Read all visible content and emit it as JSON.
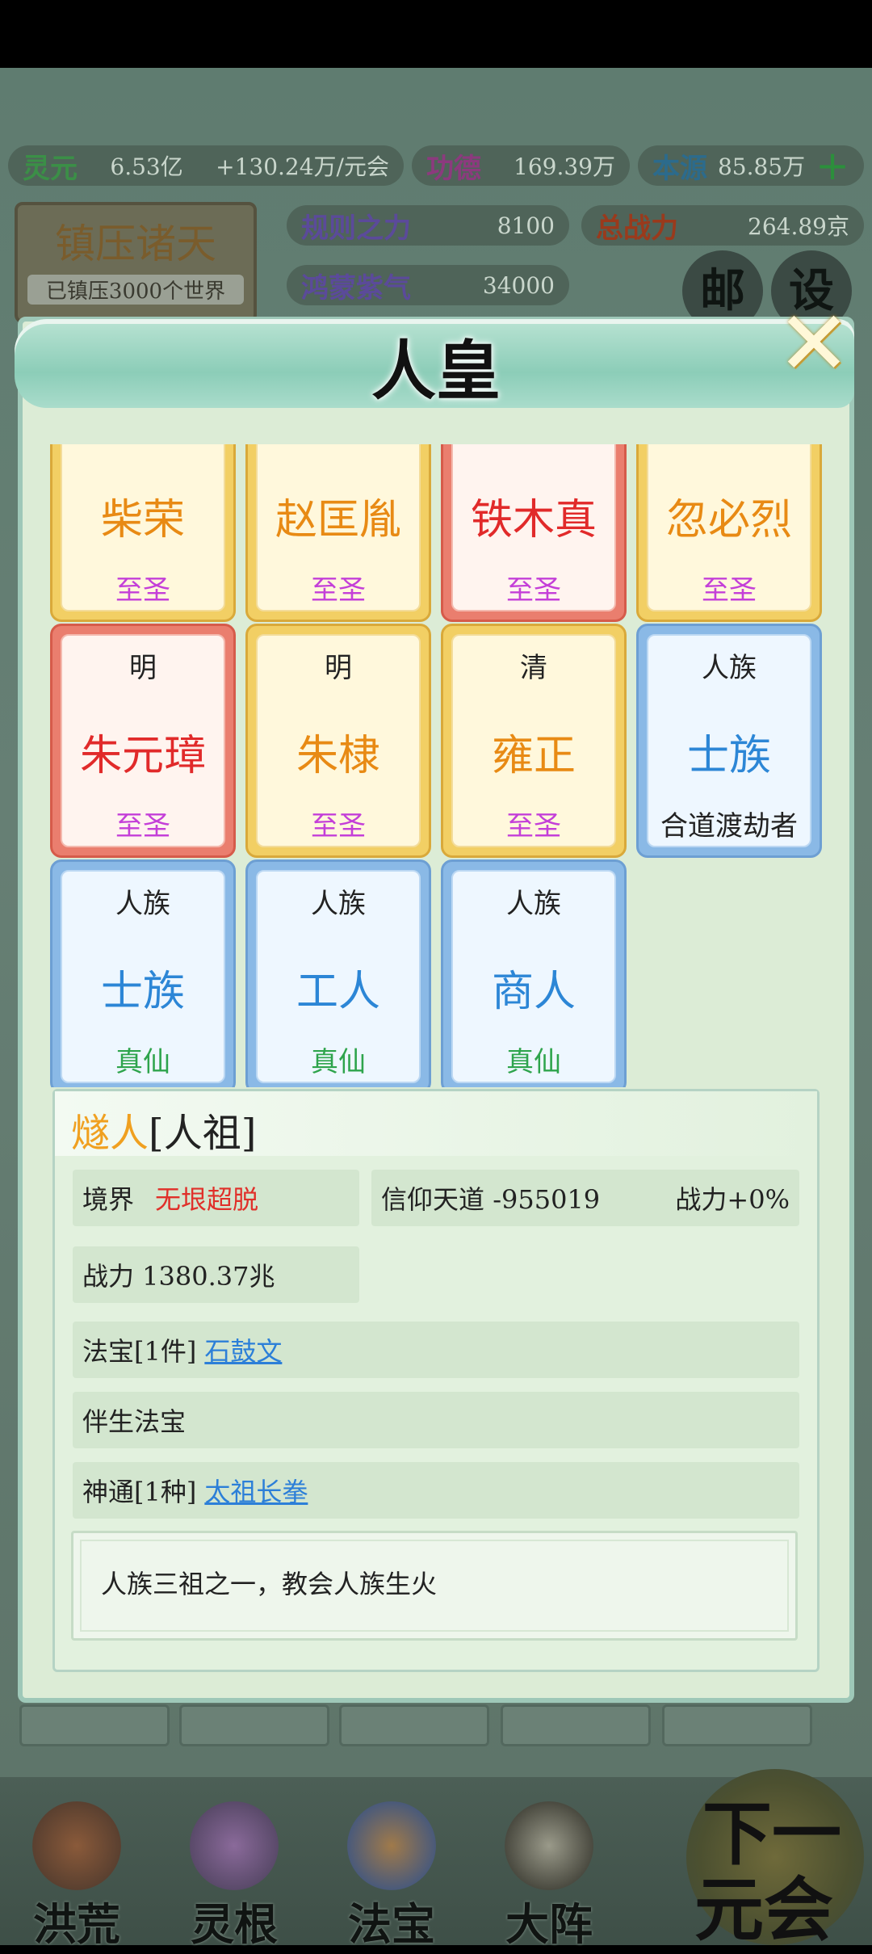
{
  "resources": {
    "lingyuan": {
      "label": "灵元",
      "value": "6.53亿",
      "rate": "+130.24万/元会"
    },
    "gongde": {
      "label": "功德",
      "value": "169.39万"
    },
    "benyuan": {
      "label": "本源",
      "value": "85.85万"
    },
    "guize": {
      "label": "规则之力",
      "value": "8100"
    },
    "zongzhanli": {
      "label": "总战力",
      "value": "264.89京"
    },
    "hongmeng": {
      "label": "鸿蒙紫气",
      "value": "34000"
    }
  },
  "title_board": {
    "title": "镇压诸天",
    "subtitle": "已镇压3000个世界"
  },
  "round_buttons": {
    "mail": "邮",
    "settings": "设"
  },
  "dialog": {
    "title": "人皇",
    "close": "✕"
  },
  "cards": [
    {
      "top": "",
      "name": "柴荣",
      "rank": "至圣",
      "style": "gold",
      "rank_color": "purple"
    },
    {
      "top": "",
      "name": "赵匡胤",
      "rank": "至圣",
      "style": "gold",
      "rank_color": "purple"
    },
    {
      "top": "",
      "name": "铁木真",
      "rank": "至圣",
      "style": "red",
      "rank_color": "purple"
    },
    {
      "top": "",
      "name": "忽必烈",
      "rank": "至圣",
      "style": "gold",
      "rank_color": "purple"
    },
    {
      "top": "明",
      "name": "朱元璋",
      "rank": "至圣",
      "style": "red",
      "rank_color": "purple"
    },
    {
      "top": "明",
      "name": "朱棣",
      "rank": "至圣",
      "style": "gold",
      "rank_color": "purple"
    },
    {
      "top": "清",
      "name": "雍正",
      "rank": "至圣",
      "style": "gold",
      "rank_color": "purple"
    },
    {
      "top": "人族",
      "name": "士族",
      "rank": "合道渡劫者",
      "style": "blue",
      "rank_color": "dark"
    },
    {
      "top": "人族",
      "name": "士族",
      "rank": "真仙",
      "style": "blue",
      "rank_color": "green"
    },
    {
      "top": "人族",
      "name": "工人",
      "rank": "真仙",
      "style": "blue",
      "rank_color": "green"
    },
    {
      "top": "人族",
      "name": "商人",
      "rank": "真仙",
      "style": "blue",
      "rank_color": "green"
    }
  ],
  "detail": {
    "name": "燧人",
    "title": "[人祖]",
    "realm_label": "境界",
    "realm_value": "无垠超脱",
    "faith_label": "信仰天道",
    "faith_value": "-955019",
    "power_bonus": "战力+0%",
    "power": "战力 1380.37兆",
    "treasure_label": "法宝[1件]",
    "treasure_link": "石鼓文",
    "companion_label": "伴生法宝",
    "skill_label": "神通[1种]",
    "skill_link": "太祖长拳",
    "description": "人族三祖之一，教会人族生火"
  },
  "bottom_nav": [
    {
      "label": "洪荒"
    },
    {
      "label": "灵根"
    },
    {
      "label": "法宝"
    },
    {
      "label": "大阵"
    }
  ],
  "next_button": {
    "line1": "下一",
    "line2": "元会"
  },
  "colors": {
    "dialog_bg": "#dcecd6",
    "gold_card": "#f2cf64",
    "red_card": "#ea7e6e",
    "blue_card": "#8ab9e6"
  }
}
